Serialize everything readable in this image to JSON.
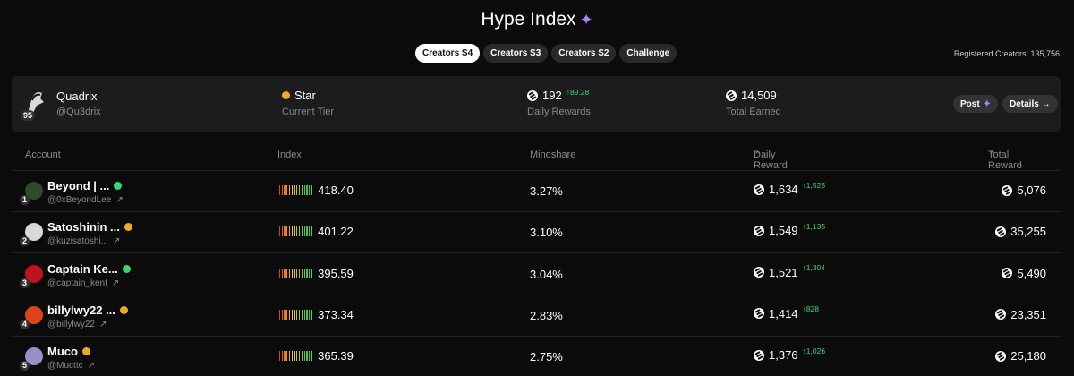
{
  "header": {
    "title": "Hype Index",
    "title_icon": "sparkle-icon"
  },
  "tabs": [
    {
      "label": "Creators S4",
      "active": true
    },
    {
      "label": "Creators S3",
      "active": false
    },
    {
      "label": "Creators S2",
      "active": false
    },
    {
      "label": "Challenge",
      "active": false
    }
  ],
  "registered": "Registered Creators: 135,756",
  "me": {
    "name": "Quadrix",
    "handle": "@Qu3drix",
    "rank": "95",
    "tier": "Star",
    "tier_label": "Current Tier",
    "daily_rewards": "192",
    "daily_change": "↑89.28",
    "daily_label": "Daily Rewards",
    "total_earned": "14,509",
    "total_label": "Total Earned",
    "post_label": "Post",
    "details_label": "Details →"
  },
  "table": {
    "columns": {
      "account": "Account",
      "index": "Index",
      "mindshare": "Mindshare",
      "daily": "Daily Reward",
      "daily_sort": "⌃",
      "total": "Total Reward",
      "total_sort": "⌃"
    },
    "rows": [
      {
        "rank": "1",
        "name": "Beyond | ...",
        "handle": "@0xBeyondLee",
        "badge": "#37d67a",
        "index": "418.40",
        "mindshare": "3.27%",
        "daily": "1,634",
        "daily_change": "↑1,525",
        "total": "5,076",
        "avatar_color": "#2e4a2b"
      },
      {
        "rank": "2",
        "name": "Satoshinin ...",
        "handle": "@kuzisatoshi...",
        "badge": "#f2a922",
        "index": "401.22",
        "mindshare": "3.10%",
        "daily": "1,549",
        "daily_change": "↑1,135",
        "total": "35,255",
        "avatar_color": "#d9d9d9"
      },
      {
        "rank": "3",
        "name": "Captain Ke...",
        "handle": "@captain_kent",
        "badge": "#37d67a",
        "index": "395.59",
        "mindshare": "3.04%",
        "daily": "1,521",
        "daily_change": "↑1,304",
        "total": "5,490",
        "avatar_color": "#c1121f"
      },
      {
        "rank": "4",
        "name": "billylwy22 ...",
        "handle": "@billylwy22",
        "badge": "#f2a922",
        "index": "373.34",
        "mindshare": "2.83%",
        "daily": "1,414",
        "daily_change": "↑828",
        "total": "23,351",
        "avatar_color": "#e0421a"
      },
      {
        "rank": "5",
        "name": "Muco",
        "handle": "@Mucttc",
        "badge": "#f2a922",
        "index": "365.39",
        "mindshare": "2.75%",
        "daily": "1,376",
        "daily_change": "↑1,026",
        "total": "25,180",
        "avatar_color": "#9a8fc4"
      }
    ]
  }
}
